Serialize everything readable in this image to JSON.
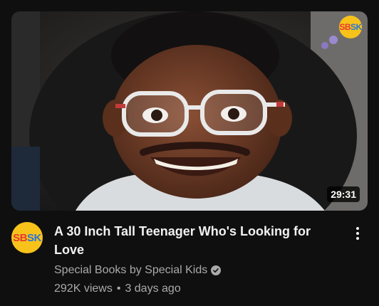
{
  "video": {
    "title": "A 30 Inch Tall Teenager Who's Looking for Love",
    "duration": "29:31",
    "channel_name": "Special Books by Special Kids",
    "channel_logo_text_1": "SB",
    "channel_logo_text_2": "SK",
    "views": "292K views",
    "separator": "•",
    "age": "3 days ago"
  },
  "icons": {
    "verified": "check-circle-icon",
    "more": "vertical-dots-icon"
  },
  "colors": {
    "background": "#0f0f0f",
    "logo_yellow": "#f7c31b",
    "logo_red": "#e8392f",
    "logo_blue": "#2b74d9",
    "secondary_text": "#aaaaaa"
  }
}
